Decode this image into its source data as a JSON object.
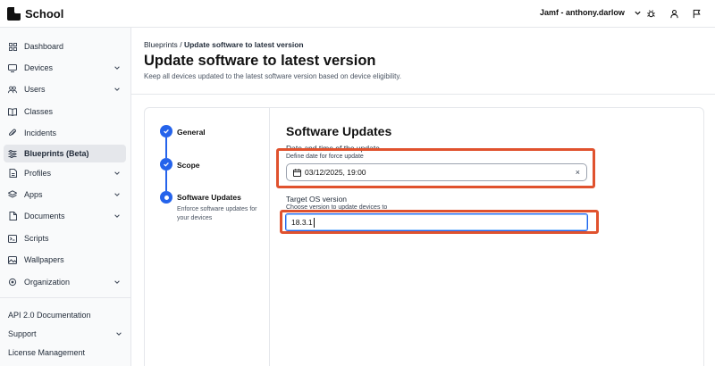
{
  "app": {
    "name": "School",
    "user": "Jamf - anthony.darlow"
  },
  "sidebar": {
    "items": [
      {
        "label": "Dashboard",
        "icon": "dashboard-icon",
        "chevron": false
      },
      {
        "label": "Devices",
        "icon": "monitor-icon",
        "chevron": true
      },
      {
        "label": "Users",
        "icon": "users-icon",
        "chevron": true
      },
      {
        "label": "Classes",
        "icon": "book-icon",
        "chevron": false
      },
      {
        "label": "Incidents",
        "icon": "paperclip-icon",
        "chevron": false
      },
      {
        "label": "Blueprints (Beta)",
        "icon": "sliders-icon",
        "chevron": false,
        "active": true
      },
      {
        "label": "Profiles",
        "icon": "profile-icon",
        "chevron": true
      },
      {
        "label": "Apps",
        "icon": "layers-icon",
        "chevron": true
      },
      {
        "label": "Documents",
        "icon": "document-icon",
        "chevron": true
      },
      {
        "label": "Scripts",
        "icon": "script-icon",
        "chevron": false
      },
      {
        "label": "Wallpapers",
        "icon": "image-icon",
        "chevron": false
      },
      {
        "label": "Organization",
        "icon": "gear-icon",
        "chevron": true
      }
    ],
    "bottom": {
      "api_docs": "API 2.0 Documentation",
      "support": "Support",
      "license": "License Management"
    }
  },
  "breadcrumb": {
    "parent": "Blueprints",
    "separator": "/",
    "current": "Update software to latest version"
  },
  "page": {
    "title": "Update software to latest version",
    "description": "Keep all devices updated to the latest software version based on device eligibility."
  },
  "steps": [
    {
      "label": "General",
      "status": "completed"
    },
    {
      "label": "Scope",
      "status": "completed"
    },
    {
      "label": "Software Updates",
      "status": "current",
      "subtitle": "Enforce software updates for your devices"
    }
  ],
  "form": {
    "section_title": "Software Updates",
    "date_label": "Date and time of the update",
    "date_help": "Define date for force update",
    "date_value": "03/12/2025, 19:00",
    "clear_symbol": "×",
    "os_label": "Target OS version",
    "os_help": "Choose version to update devices to",
    "os_value": "18.3.1"
  },
  "colors": {
    "accent": "#2563eb",
    "highlight": "#e0522e"
  }
}
